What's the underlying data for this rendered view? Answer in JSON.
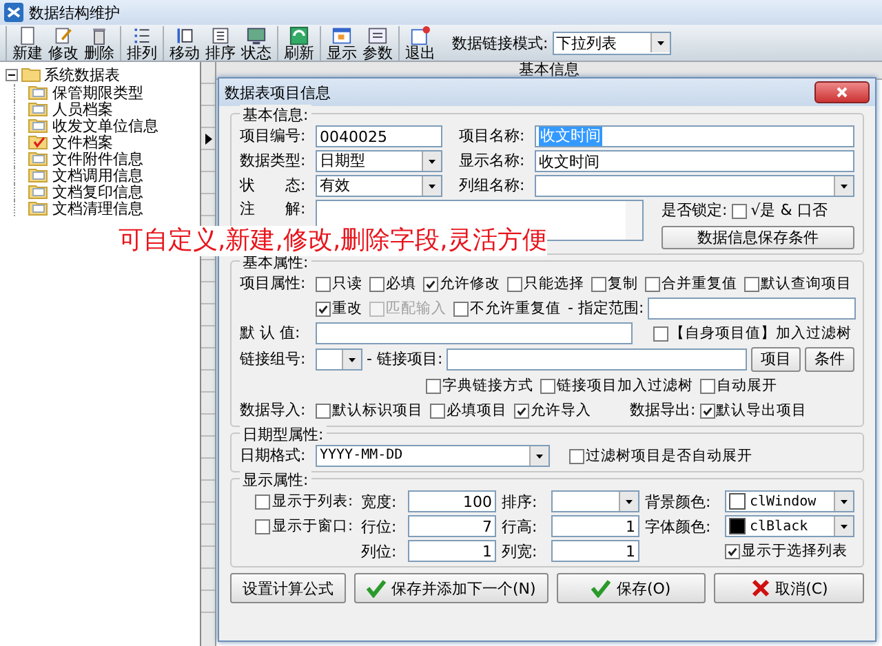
{
  "window": {
    "title": "数据结构维护"
  },
  "toolbar": {
    "groups": [
      {
        "buttons": [
          {
            "label": "新建"
          },
          {
            "label": "修改"
          },
          {
            "label": "删除"
          }
        ]
      },
      {
        "buttons": [
          {
            "label": "排列"
          }
        ]
      },
      {
        "buttons": [
          {
            "label": "移动"
          },
          {
            "label": "排序"
          },
          {
            "label": "状态"
          }
        ]
      },
      {
        "buttons": [
          {
            "label": "刷新"
          }
        ]
      },
      {
        "buttons": [
          {
            "label": "显示"
          },
          {
            "label": "参数"
          }
        ]
      },
      {
        "buttons": [
          {
            "label": "退出"
          }
        ]
      }
    ],
    "link_mode": {
      "label": "数据链接模式:",
      "value": "下拉列表"
    }
  },
  "tree": {
    "label": "系统数据表",
    "expanded": true,
    "children": [
      {
        "label": "保管期限类型",
        "selected": false
      },
      {
        "label": "人员档案",
        "selected": false
      },
      {
        "label": "收发文单位信息",
        "selected": false
      },
      {
        "label": "文件档案",
        "selected": true
      },
      {
        "label": "文件附件信息",
        "selected": false
      },
      {
        "label": "文档调用信息",
        "selected": false
      },
      {
        "label": "文档复印信息",
        "selected": false
      },
      {
        "label": "文档清理信息",
        "selected": false
      }
    ]
  },
  "background_panel": {
    "header": "基本信息"
  },
  "dialog": {
    "title": "数据表项目信息",
    "basic_info": {
      "title": "基本信息:",
      "item_code": {
        "label": "项目编号:",
        "value": "0040025"
      },
      "item_name": {
        "label": "项目名称:",
        "value": "收文时间",
        "selected": true
      },
      "data_type": {
        "label": "数据类型:",
        "value": "日期型"
      },
      "display_name": {
        "label": "显示名称:",
        "value": "收文时间"
      },
      "status": {
        "label": "状　　态:",
        "value": "有效"
      },
      "column_group": {
        "label": "列组名称:"
      },
      "note": {
        "label": "注　　解:"
      },
      "lock": {
        "label": "是否锁定:",
        "checked": false,
        "text": "√是 & 口否"
      },
      "save_conditions_button": "数据信息保存条件"
    },
    "basic_props": {
      "title": "基本属性:",
      "item_props_label": "项目属性:",
      "item_props": [
        {
          "label": "只读",
          "checked": false,
          "disabled": false
        },
        {
          "label": "必填",
          "checked": false,
          "disabled": false
        },
        {
          "label": "允许修改",
          "checked": true,
          "disabled": false
        },
        {
          "label": "只能选择",
          "checked": false,
          "disabled": false
        },
        {
          "label": "复制",
          "checked": false,
          "disabled": false
        },
        {
          "label": "合并重复值",
          "checked": false,
          "disabled": false
        },
        {
          "label": "默认查询项目",
          "checked": false,
          "disabled": false
        },
        {
          "label": "重改",
          "checked": true,
          "disabled": false
        },
        {
          "label": "匹配输入",
          "checked": false,
          "disabled": true
        },
        {
          "label": "不允许重复值",
          "checked": false,
          "disabled": false
        }
      ],
      "range": {
        "label": "- 指定范围:"
      },
      "default_value": {
        "label": "默 认 值:"
      },
      "self_filter": {
        "label": "【自身项目值】加入过滤树",
        "checked": false
      },
      "link_group": {
        "label": "链接组号:"
      },
      "link_item": {
        "label": "- 链接项目:"
      },
      "link_buttons": [
        "项目",
        "条件"
      ],
      "link_options": [
        {
          "label": "字典链接方式",
          "checked": false
        },
        {
          "label": "链接项目加入过滤树",
          "checked": false
        },
        {
          "label": "自动展开",
          "checked": false
        }
      ],
      "import": {
        "label": "数据导入:",
        "options": [
          {
            "label": "默认标识项目",
            "checked": false
          },
          {
            "label": "必填项目",
            "checked": false
          },
          {
            "label": "允许导入",
            "checked": true
          }
        ]
      },
      "export": {
        "label": "数据导出:",
        "options": [
          {
            "label": "默认导出项目",
            "checked": true
          }
        ]
      }
    },
    "date_props": {
      "title": "日期型属性:",
      "format": {
        "label": "日期格式:",
        "value": "YYYY-MM-DD"
      },
      "auto_expand": {
        "label": "过滤树项目是否自动展开",
        "checked": false
      }
    },
    "display_props": {
      "title": "显示属性:",
      "show_in_list": {
        "label": "显示于列表:",
        "checked": false
      },
      "width": {
        "label": "宽度:",
        "value": "100"
      },
      "sort": {
        "label": "排序:"
      },
      "bg_color": {
        "label": "背景颜色:",
        "value": "clWindow",
        "color": "#ffffff"
      },
      "show_in_window": {
        "label": "显示于窗口:",
        "checked": false
      },
      "row": {
        "label": "行位:",
        "value": "7"
      },
      "row_height": {
        "label": "行高:",
        "value": "1"
      },
      "font_color": {
        "label": "字体颜色:",
        "value": "clBlack",
        "color": "#000000"
      },
      "col": {
        "label": "列位:",
        "value": "1"
      },
      "col_width": {
        "label": "列宽:",
        "value": "1"
      },
      "show_in_select": {
        "label": "显示于选择列表",
        "checked": true
      }
    },
    "buttons": [
      {
        "label": "设置计算公式",
        "kind": "plain"
      },
      {
        "label": "保存并添加下一个(N)",
        "kind": "ok"
      },
      {
        "label": "保存(O)",
        "kind": "ok"
      },
      {
        "label": "取消(C)",
        "kind": "cancel"
      }
    ]
  },
  "annotation": "可自定义,新建,修改,删除字段,灵活方便"
}
